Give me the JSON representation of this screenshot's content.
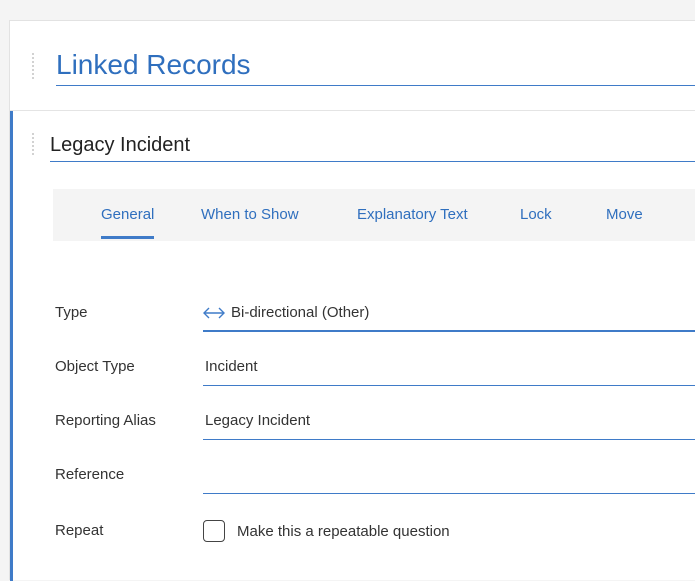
{
  "section": {
    "title": "Linked Records"
  },
  "question": {
    "title": "Legacy Incident",
    "tabs": [
      {
        "label": "General",
        "active": true
      },
      {
        "label": "When to Show",
        "active": false
      },
      {
        "label": "Explanatory Text",
        "active": false
      },
      {
        "label": "Lock",
        "active": false
      },
      {
        "label": "Move",
        "active": false
      }
    ],
    "fields": {
      "type": {
        "label": "Type",
        "value": "Bi-directional (Other)",
        "icon": "bidirectional-arrow-icon"
      },
      "object_type": {
        "label": "Object Type",
        "value": "Incident"
      },
      "reporting_alias": {
        "label": "Reporting Alias",
        "value": "Legacy Incident"
      },
      "reference": {
        "label": "Reference",
        "value": ""
      },
      "repeat": {
        "label": "Repeat",
        "checkbox_label": "Make this a repeatable question",
        "checked": false
      }
    }
  },
  "colors": {
    "accent": "#3f7bc8",
    "title_blue": "#2f6fbe",
    "tab_bar_bg": "#f4f4f4"
  }
}
